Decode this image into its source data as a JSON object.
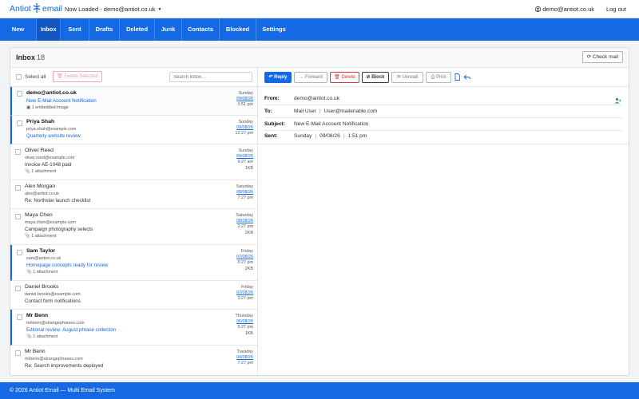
{
  "topbar": {
    "brand_left": "Antiot",
    "brand_right": "email",
    "account_label": "Now Loaded - demo@antiot.co.uk",
    "user_email": "demo@antiot.co.uk",
    "logout_label": "Log out"
  },
  "nav": {
    "items": [
      "New",
      "Inbox",
      "Sent",
      "Drafts",
      "Deleted",
      "Junk",
      "Contacts",
      "Blocked",
      "Settings"
    ],
    "active": "Inbox"
  },
  "inbox": {
    "title": "Inbox",
    "count": "18",
    "check_mail_label": "Check mail",
    "select_all_label": "Select all",
    "delete_selected_label": "Delete Selected",
    "search_placeholder": "Search inbox..."
  },
  "messages": [
    {
      "from": "demo@antiot.co.uk",
      "email": "",
      "subject": "New E-Mail Account Notification",
      "extra": "1 embedded image",
      "day": "Sunday",
      "date": "09/08/26",
      "time": "1:51 pm",
      "size": "",
      "unread": true,
      "selected": true
    },
    {
      "from": "Priya Shah",
      "email": "priya.shah@example.com",
      "subject": "Quarterly website review",
      "extra": "",
      "day": "Sunday",
      "date": "09/08/26",
      "time": "12:27 pm",
      "size": "",
      "unread": true,
      "selected": false
    },
    {
      "from": "Oliver Reed",
      "email": "oliver.reed@example.com",
      "subject": "Invoice AE-1048 paid",
      "extra": "1 attachment",
      "day": "Sunday",
      "date": "09/08/26",
      "time": "9:27 am",
      "size": "1KB",
      "unread": false,
      "selected": false
    },
    {
      "from": "Alex Morgan",
      "email": "alex@antiot.co.uk",
      "subject": "Re: Northstar launch checklist",
      "extra": "",
      "day": "Saturday",
      "date": "08/08/26",
      "time": "7:27 pm",
      "size": "",
      "unread": false,
      "selected": false
    },
    {
      "from": "Maya Chen",
      "email": "maya.chen@example.com",
      "subject": "Campaign photography selects",
      "extra": "1 attachment",
      "day": "Saturday",
      "date": "08/08/26",
      "time": "2:27 pm",
      "size": "2KB",
      "unread": false,
      "selected": false
    },
    {
      "from": "Sam Taylor",
      "email": "sam@antiot.co.uk",
      "subject": "Homepage concepts ready for review",
      "extra": "1 attachment",
      "day": "Friday",
      "date": "07/08/26",
      "time": "5:27 pm",
      "size": "2KB",
      "unread": true,
      "selected": false
    },
    {
      "from": "Daniel Brooks",
      "email": "daniel.brooks@example.com",
      "subject": "Contact form notifications",
      "extra": "",
      "day": "Friday",
      "date": "07/08/26",
      "time": "3:27 pm",
      "size": "",
      "unread": false,
      "selected": false
    },
    {
      "from": "Mr Benn",
      "email": "mrbenn@strangephrases.com",
      "subject": "Editorial review: August phrase collection",
      "extra": "1 attachment",
      "day": "Thursday",
      "date": "06/08/26",
      "time": "5:27 pm",
      "size": "1KB",
      "unread": true,
      "selected": false
    },
    {
      "from": "Mr Benn",
      "email": "mrbenn@strangephrases.com",
      "subject": "Re: Search improvements deployed",
      "extra": "",
      "day": "Tuesday",
      "date": "04/08/26",
      "time": "7:27 pm",
      "size": "",
      "unread": false,
      "selected": false
    }
  ],
  "reader": {
    "buttons": {
      "reply": "Reply",
      "forward": "Forward",
      "delete": "Delete",
      "block": "Block",
      "unread": "Unread",
      "print": "Print"
    },
    "labels": {
      "from": "From:",
      "to": "To:",
      "subject": "Subject:",
      "sent": "Sent:"
    },
    "from_value": "demo@antiot.co.uk",
    "to_name": "Mail User",
    "to_email": "User@mailenable.com",
    "subject_value": "New E-Mail Account Notification",
    "sent_day": "Sunday",
    "sent_date": "09/08/26",
    "sent_time": "1:51 pm"
  },
  "footer": {
    "text": "© 2026 Antiot Email — Multi Email System"
  },
  "colors": {
    "primary": "#1669e4",
    "danger": "#dc3545",
    "dark": "#343a40"
  }
}
